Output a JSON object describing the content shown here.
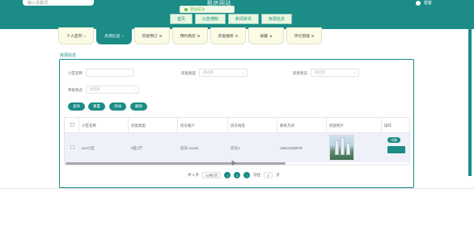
{
  "header": {
    "search_placeholder": "输入关键词",
    "site_title": "租房网站",
    "user_name": "租客"
  },
  "toast": {
    "text": "登录成功"
  },
  "top_nav": [
    {
      "label": "首页"
    },
    {
      "label": "公告通知"
    },
    {
      "label": "新闻资讯"
    },
    {
      "label": "房源信息"
    }
  ],
  "tabs": [
    {
      "label": "个人首页",
      "icon": "home-icon",
      "active": false
    },
    {
      "label": "房源信息",
      "icon": "home-icon",
      "active": true
    },
    {
      "label": "房屋预订",
      "icon": "gear-icon",
      "active": false
    },
    {
      "label": "预约看房",
      "icon": "gear-icon",
      "active": false
    },
    {
      "label": "房屋报修",
      "icon": "gear-icon",
      "active": false
    },
    {
      "label": "收藏",
      "icon": "star-icon",
      "active": false
    },
    {
      "label": "评论管理",
      "icon": "gear-icon",
      "active": false
    }
  ],
  "section_title": "房源信息",
  "filters": {
    "community_label": "小区名称",
    "community_value": "",
    "house_type_label": "房屋类型",
    "house_type_placeholder": "请选择",
    "house_status_label": "房屋状态",
    "house_status_placeholder": "请选择",
    "review_label": "审核状态",
    "review_placeholder": "请选择"
  },
  "buttons": {
    "query": "查询",
    "reset": "重置",
    "add": "添加",
    "delete": "删除"
  },
  "table": {
    "headers": [
      "小区名称",
      "房屋类型",
      "房东账户",
      "房东姓名",
      "联系方式",
      "房屋照片",
      "操作"
    ],
    "rows": [
      {
        "community": "xxx小区",
        "house_type": "3室1厅",
        "landlord_account": "房东-xxxx6",
        "landlord_name": "房东1",
        "contact": "13812345678",
        "action_label": "详情"
      }
    ]
  },
  "pagination": {
    "total_text": "共 1 条",
    "page_size": "10条/页",
    "prev": "‹",
    "current": "1",
    "next": "›",
    "goto_label": "前往",
    "goto_value": "1",
    "page_suffix": "页"
  },
  "colors": {
    "accent": "#1b8c86",
    "tab_bg": "#fbfbe6",
    "row_bg": "#eef1f9"
  }
}
